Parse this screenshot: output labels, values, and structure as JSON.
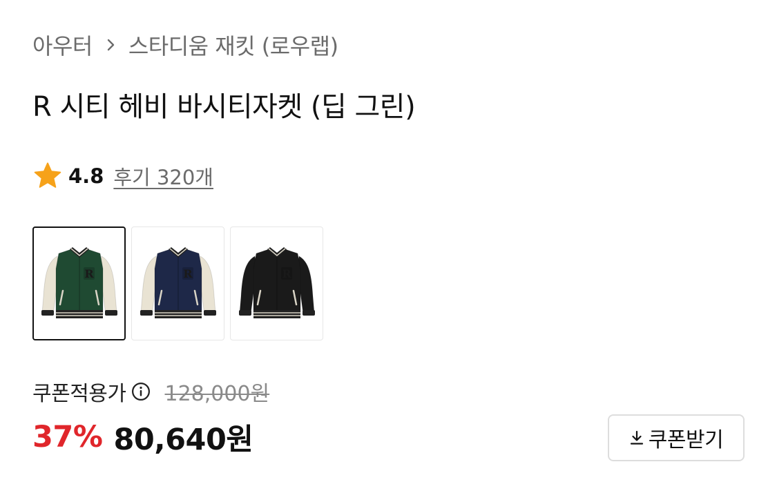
{
  "breadcrumb": {
    "parent": "아우터",
    "current": "스타디움 재킷 (로우랩)"
  },
  "product": {
    "title": "R 시티 헤비 바시티자켓 (딥 그린)"
  },
  "rating": {
    "score": "4.8",
    "reviews_label": "후기 320개",
    "star_color": "#F6A21A"
  },
  "thumbnails": [
    {
      "color_name": "green",
      "body_color": "#1f4a32",
      "sleeve_color": "#e9e3d3",
      "selected": true
    },
    {
      "color_name": "navy",
      "body_color": "#1e2848",
      "sleeve_color": "#e9e3d3",
      "selected": false
    },
    {
      "color_name": "black",
      "body_color": "#1a1a1a",
      "sleeve_color": "#1a1a1a",
      "selected": false
    }
  ],
  "price": {
    "label": "쿠폰적용가",
    "original": "128,000원",
    "discount": "37%",
    "final": "80,640원",
    "discount_color": "#E0262B"
  },
  "coupon_button": {
    "label": "쿠폰받기"
  }
}
